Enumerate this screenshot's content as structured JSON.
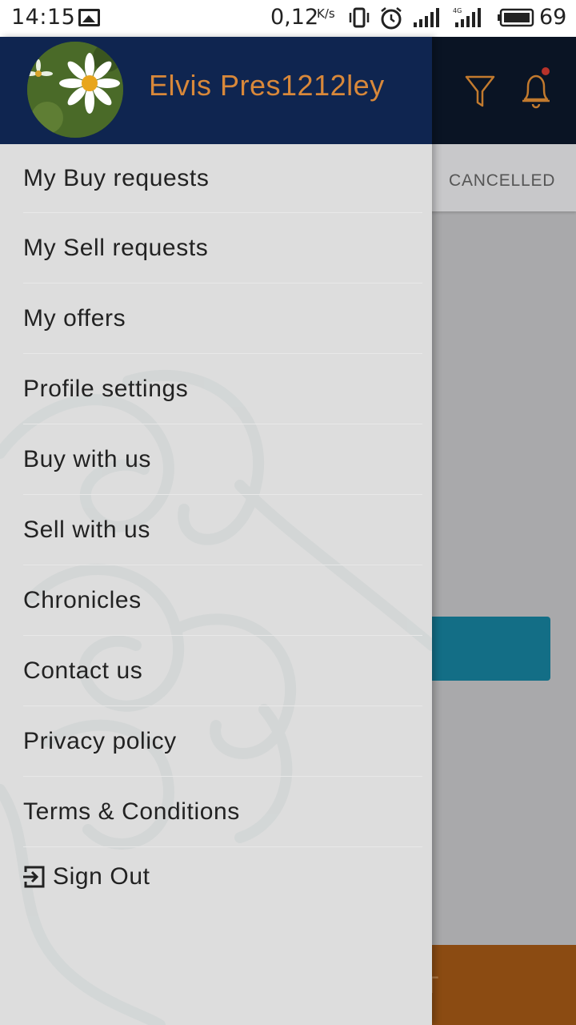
{
  "status_bar": {
    "time": "14:15",
    "net_speed": "0,12",
    "net_speed_unit": "K/s",
    "battery": "69",
    "icons": [
      "image-icon",
      "vibrate-icon",
      "alarm-icon",
      "signal-icon",
      "signal-4g-icon",
      "battery-icon"
    ]
  },
  "background_app": {
    "tab_label": "CANCELLED",
    "bottom_button_text": "T",
    "colors": {
      "header": "#0a1424",
      "teal_button": "#136e86",
      "orange_bar": "#8b4b12"
    }
  },
  "drawer": {
    "user_name": "Elvis Pres1212ley",
    "avatar": "daisy-flower-avatar",
    "items": [
      {
        "label": "My Buy requests"
      },
      {
        "label": "My Sell requests"
      },
      {
        "label": "My offers"
      },
      {
        "label": "Profile settings"
      },
      {
        "label": "Buy with us"
      },
      {
        "label": "Sell with us"
      },
      {
        "label": "Chronicles"
      },
      {
        "label": "Contact us"
      },
      {
        "label": "Privacy policy"
      },
      {
        "label": "Terms & Conditions"
      }
    ],
    "sign_out_label": "Sign Out",
    "colors": {
      "header": "#0f2550",
      "user_name": "#d8883a",
      "background": "#dddddd"
    }
  }
}
